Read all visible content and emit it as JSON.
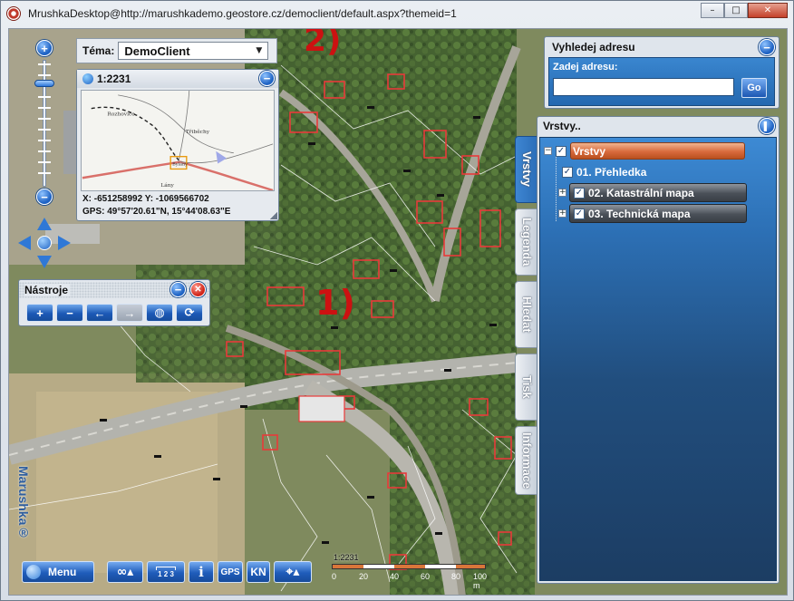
{
  "window": {
    "title": "MrushkaDesktop@http://marushkademo.geostore.cz/democlient/default.aspx?themeid=1",
    "buttons": {
      "minimize": "–",
      "maximize": "□",
      "close": "✕"
    }
  },
  "annotations": {
    "label_1": "1)",
    "label_2": "2)"
  },
  "theme": {
    "label": "Téma:",
    "value": "DemoClient"
  },
  "overview": {
    "scale": "1:2231",
    "coords": "X: -651258992 Y: -1069566702",
    "gps": "GPS: 49°57'20.61\"N, 15°44'08.63\"E",
    "place_labels": [
      "Rozhovice",
      "Třiběchy",
      "Bylany",
      "Lány"
    ]
  },
  "tools_panel": {
    "title": "Nástroje",
    "tools": [
      "zoom-in",
      "zoom-out",
      "back",
      "forward",
      "info",
      "refresh"
    ]
  },
  "address_search": {
    "title": "Vyhledej adresu",
    "label": "Zadej adresu:",
    "value": "",
    "button": "Go"
  },
  "layers_panel": {
    "title": "Vrstvy..",
    "root": "Vrstvy",
    "items": [
      {
        "label": "01. Přehledka",
        "checked": true,
        "expandable": false
      },
      {
        "label": "02. Katastrální mapa",
        "checked": true,
        "expandable": true
      },
      {
        "label": "03. Technická mapa",
        "checked": true,
        "expandable": true
      }
    ]
  },
  "side_tabs": [
    "Vrstvy",
    "Legenda",
    "Hledat",
    "Tisk",
    "Informace"
  ],
  "bottom_toolbar": {
    "menu": "Menu",
    "gps": "GPS",
    "kn": "KN",
    "info": "i",
    "scalebar_label": "1 2 3"
  },
  "scalebar": {
    "scale": "1:2231",
    "ticks": [
      "0",
      "20",
      "40",
      "60",
      "80",
      "100 m"
    ]
  },
  "branding": "Marushka®",
  "colors": {
    "accent": "#1f5cba",
    "layer_root": "#d9764a",
    "panel_bg": "#1e3d63",
    "annotation": "#cc1111"
  }
}
